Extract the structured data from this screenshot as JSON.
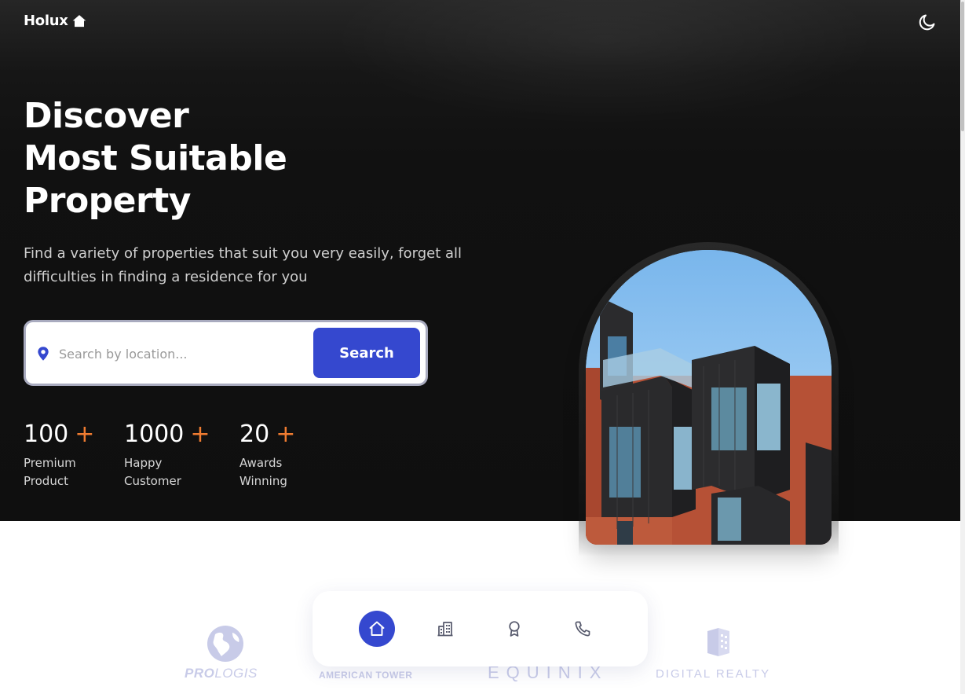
{
  "brand": {
    "name": "Holux",
    "icon": "home-icon"
  },
  "theme_toggle": {
    "icon": "moon-icon"
  },
  "hero": {
    "headline": [
      "Discover",
      "Most Suitable",
      "Property"
    ],
    "subtitle": "Find a variety of properties that suit you very easily, forget all difficulties in finding a residence for you"
  },
  "search": {
    "placeholder": "Search by location...",
    "value": "",
    "button_label": "Search",
    "icon": "location-pin-icon"
  },
  "stats": [
    {
      "value": "100",
      "suffix": "+",
      "label_line1": "Premium",
      "label_line2": "Product"
    },
    {
      "value": "1000",
      "suffix": "+",
      "label_line1": "Happy",
      "label_line2": "Customer"
    },
    {
      "value": "20",
      "suffix": "+",
      "label_line1": "Awards",
      "label_line2": "Winning"
    }
  ],
  "partners": [
    {
      "name": "PROLOGIS",
      "part1": "PRO",
      "part2": "LOGIS"
    },
    {
      "name": "AMERICAN TOWER"
    },
    {
      "name": "EQUINIX"
    },
    {
      "name": "DIGITAL REALTY"
    }
  ],
  "bottom_nav": [
    {
      "name": "home",
      "icon": "home-icon",
      "active": true
    },
    {
      "name": "properties",
      "icon": "building-icon",
      "active": false
    },
    {
      "name": "awards",
      "icon": "award-icon",
      "active": false
    },
    {
      "name": "contact",
      "icon": "phone-icon",
      "active": false
    }
  ],
  "colors": {
    "accent": "#3548cf",
    "plus": "#f07c31",
    "hero_bg": "#111111",
    "partner_logo": "#c8cbe8"
  }
}
